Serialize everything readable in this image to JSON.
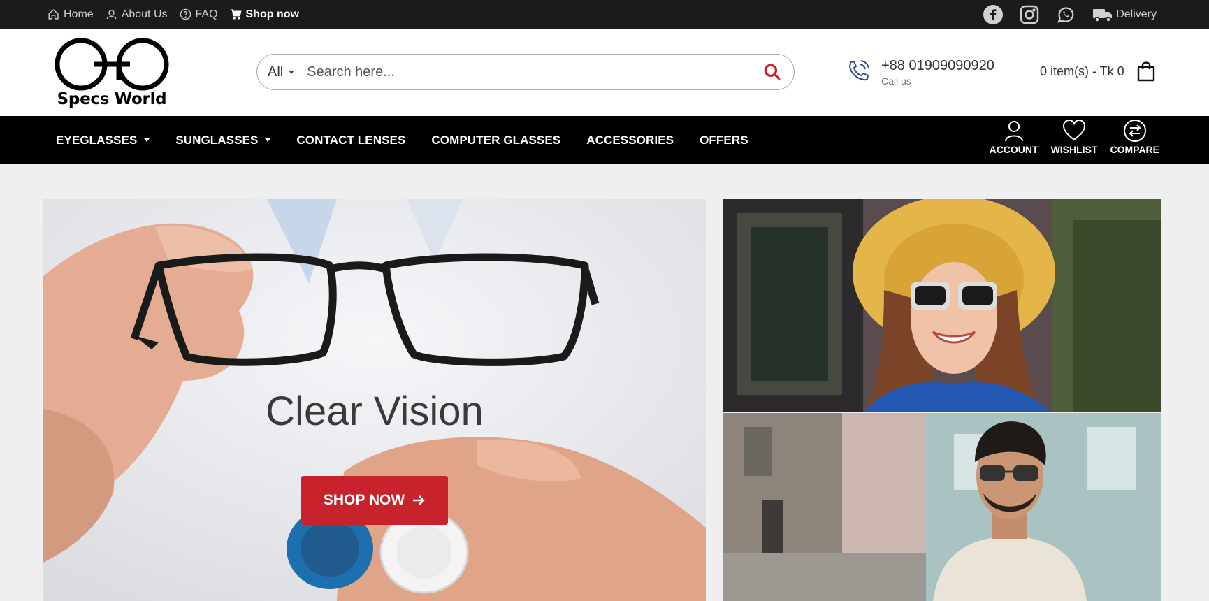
{
  "topbar": {
    "home_label": "Home",
    "about_label": "About Us",
    "faq_label": "FAQ",
    "shop_label": "Shop now",
    "social": [
      "facebook-icon",
      "instagram-icon",
      "whatsapp-icon"
    ],
    "delivery_label": "Delivery"
  },
  "header": {
    "logo_text": "Specs World",
    "search": {
      "category": "All",
      "placeholder": "Search here..."
    },
    "phone": {
      "number": "+88 01909090920",
      "label": "Call us"
    },
    "cart": {
      "summary": "0 item(s) - Tk 0"
    }
  },
  "nav": {
    "items": [
      {
        "label": "EYEGLASSES",
        "dropdown": true
      },
      {
        "label": "SUNGLASSES",
        "dropdown": true
      },
      {
        "label": "CONTACT LENSES",
        "dropdown": false
      },
      {
        "label": "COMPUTER GLASSES",
        "dropdown": false
      },
      {
        "label": "ACCESSORIES",
        "dropdown": false
      },
      {
        "label": "OFFERS",
        "dropdown": false
      }
    ],
    "actions": {
      "account_label": "ACCOUNT",
      "wishlist_label": "WISHLIST",
      "compare_label": "COMPARE"
    }
  },
  "hero": {
    "title": "Clear Vision",
    "cta_label": "SHOP NOW"
  },
  "colors": {
    "accent_red": "#c8232c",
    "topbar_bg": "#1b1b1b",
    "nav_bg": "#000000",
    "page_bg": "#efefef"
  }
}
